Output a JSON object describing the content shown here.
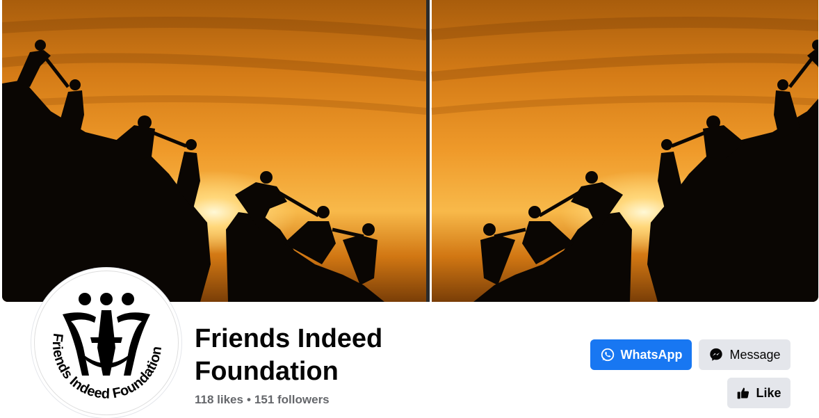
{
  "page": {
    "name": "Friends Indeed Foundation",
    "likes": "118 likes",
    "separator": "•",
    "followers": "151 followers"
  },
  "logo": {
    "ring_text": "Friends Indeed Foundation"
  },
  "actions": {
    "whatsapp_label": "WhatsApp",
    "message_label": "Message",
    "like_label": "Like"
  },
  "icons": {
    "whatsapp": "whatsapp-icon",
    "message": "messenger-icon",
    "like": "thumbs-up-icon"
  },
  "colors": {
    "primary": "#1877f2",
    "secondary_button": "#e4e6eb",
    "text_primary": "#050505",
    "text_secondary": "#65676b",
    "sunset_orange": "#e8891c"
  }
}
